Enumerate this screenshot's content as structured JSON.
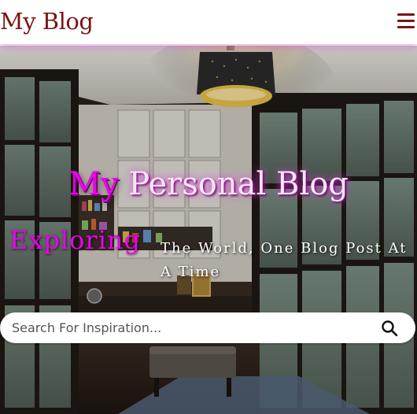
{
  "navbar": {
    "brand": "My Blog",
    "menu_icon": "hamburger-icon"
  },
  "hero": {
    "title_accent": "My",
    "title_rest": " Personal Blog",
    "tagline_accent": "Exploring",
    "tagline_rest": "The World, One Blog Post At A Time",
    "background": "interior-room-photo"
  },
  "search": {
    "placeholder": "Search For Inspiration...",
    "icon": "search-icon"
  },
  "colors": {
    "brand": "#7a1414",
    "accent": "#ee00ee"
  }
}
